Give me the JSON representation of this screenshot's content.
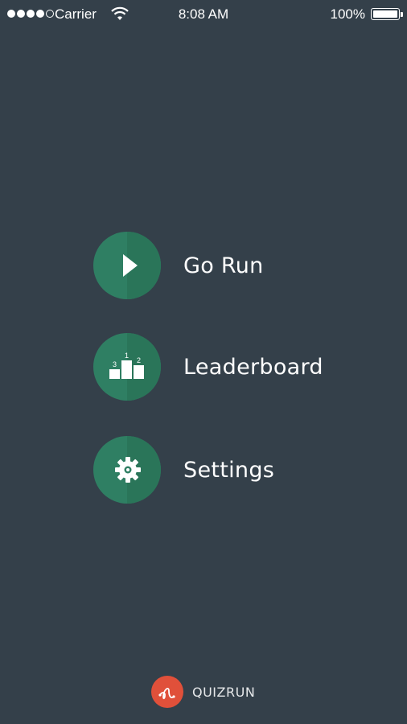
{
  "status_bar": {
    "carrier": "Carrier",
    "time": "8:08 AM",
    "battery": "100%",
    "signal_bars_filled": 4,
    "signal_bars_total": 5
  },
  "menu": {
    "items": [
      {
        "label": "Go Run",
        "icon": "play-icon"
      },
      {
        "label": "Leaderboard",
        "icon": "podium-icon",
        "podium_numbers": [
          "3",
          "1",
          "2"
        ]
      },
      {
        "label": "Settings",
        "icon": "gear-icon"
      }
    ]
  },
  "footer": {
    "brand": "QUIZRUN",
    "icon": "route-icon"
  },
  "colors": {
    "background": "#34404a",
    "button": "#2f7f63",
    "logo": "#e0503a",
    "text": "#ffffff"
  }
}
